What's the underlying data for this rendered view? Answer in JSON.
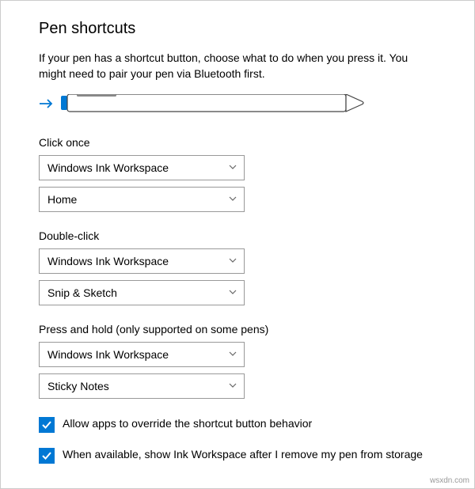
{
  "title": "Pen shortcuts",
  "description": "If your pen has a shortcut button, choose what to do when you press it. You might need to pair your pen via Bluetooth first.",
  "sections": {
    "click_once": {
      "label": "Click once",
      "primary": "Windows Ink Workspace",
      "secondary": "Home"
    },
    "double_click": {
      "label": "Double-click",
      "primary": "Windows Ink Workspace",
      "secondary": "Snip & Sketch"
    },
    "press_hold": {
      "label": "Press and hold (only supported on some pens)",
      "primary": "Windows Ink Workspace",
      "secondary": "Sticky Notes"
    }
  },
  "checkboxes": {
    "override": {
      "label": "Allow apps to override the shortcut button behavior",
      "checked": true
    },
    "show_workspace": {
      "label": "When available, show Ink Workspace after I remove my pen from storage",
      "checked": true
    }
  },
  "colors": {
    "accent": "#0078d4"
  },
  "watermark": "wsxdn.com"
}
